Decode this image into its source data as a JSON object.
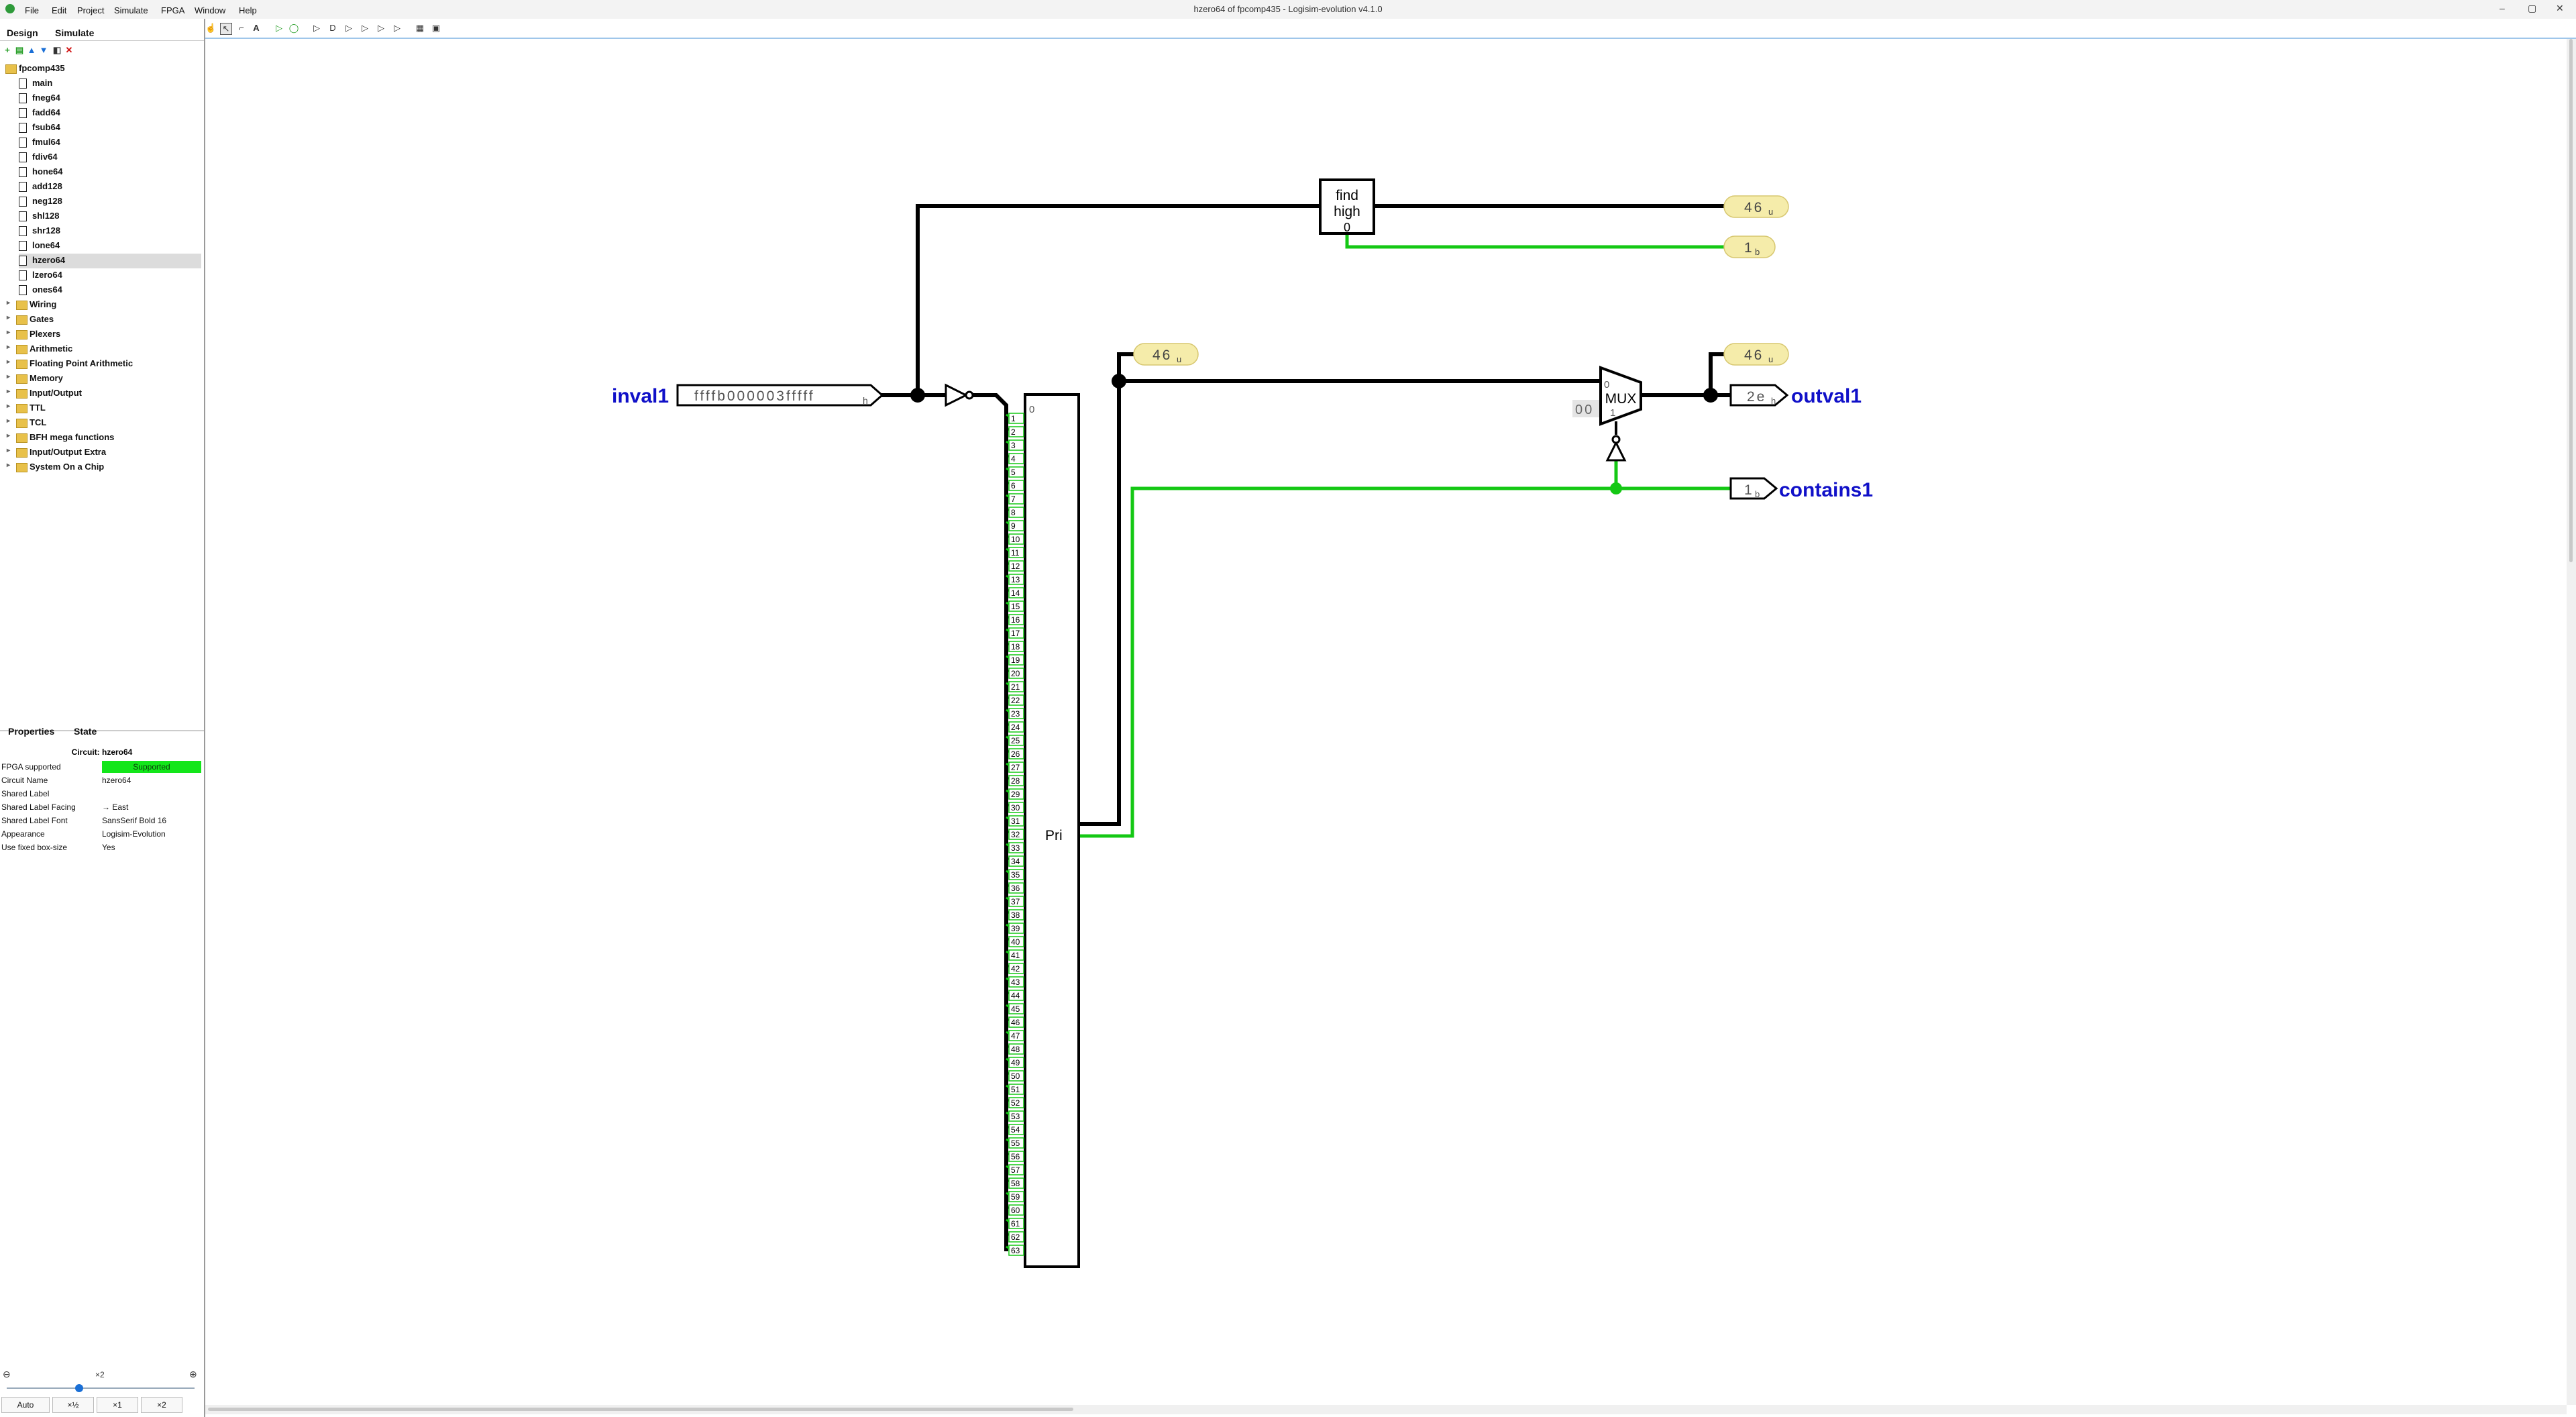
{
  "window": {
    "title": "hzero64 of fpcomp435 - Logisim-evolution v4.1.0",
    "controls": [
      "–",
      "▢",
      "✕"
    ]
  },
  "menu": [
    "File",
    "Edit",
    "Project",
    "Simulate",
    "FPGA",
    "Window",
    "Help"
  ],
  "left_tabs": {
    "design": "Design",
    "simulate": "Simulate"
  },
  "tree": {
    "project": "fpcomp435",
    "circuits": [
      "main",
      "fneg64",
      "fadd64",
      "fsub64",
      "fmul64",
      "fdiv64",
      "hone64",
      "add128",
      "neg128",
      "shl128",
      "shr128",
      "lone64",
      "hzero64",
      "lzero64",
      "ones64"
    ],
    "selected": "hzero64",
    "libraries": [
      "Wiring",
      "Gates",
      "Plexers",
      "Arithmetic",
      "Floating Point Arithmetic",
      "Memory",
      "Input/Output",
      "TTL",
      "TCL",
      "BFH mega functions",
      "Input/Output Extra",
      "System On a Chip"
    ]
  },
  "props_tabs": {
    "properties": "Properties",
    "state": "State"
  },
  "properties": {
    "header": "Circuit: hzero64",
    "rows": [
      {
        "key": "FPGA supported",
        "value": "Supported"
      },
      {
        "key": "Circuit Name",
        "value": "hzero64"
      },
      {
        "key": "Shared Label",
        "value": ""
      },
      {
        "key": "Shared Label Facing",
        "value": "→ East"
      },
      {
        "key": "Shared Label Font",
        "value": "SansSerif Bold 16"
      },
      {
        "key": "Appearance",
        "value": "Logisim-Evolution"
      },
      {
        "key": "Use fixed box-size",
        "value": "Yes"
      }
    ]
  },
  "zoom": {
    "level": "×2",
    "buttons": [
      "Auto",
      "×½",
      "×1",
      "×2"
    ]
  },
  "circuit": {
    "input_label": "inval1",
    "input_value": "ffffb000003fffff",
    "input_radix": "h",
    "find_high_label": "find high",
    "find_high_out": "0",
    "probe_top_value": "46",
    "probe_top_radix": "u",
    "probe_bit_value": "1",
    "probe_bit_radix": "b",
    "probe_pri_value": "46",
    "probe_pri_radix": "u",
    "probe_mux_value": "46",
    "probe_mux_radix": "u",
    "mux_label": "MUX",
    "mux_in0": "0",
    "mux_in1": "1",
    "mux_const": "00",
    "pri_label": "Pri",
    "pri_in0": "0",
    "outval_label": "outval1",
    "outval_value": "2e",
    "outval_radix": "h",
    "contains_label": "contains1",
    "contains_value": "1",
    "contains_radix": "b",
    "splitter_count": 64,
    "colors": {
      "label": "#1010c8",
      "wire_bus": "#000000",
      "wire_true": "#14c814",
      "probe": "#f5ecaa"
    }
  }
}
